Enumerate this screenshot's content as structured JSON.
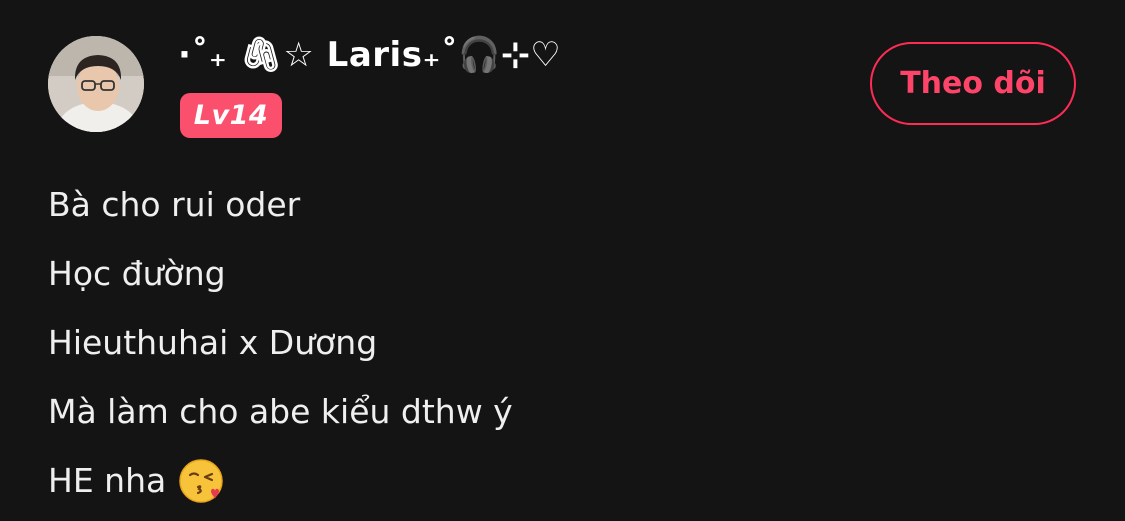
{
  "profile": {
    "username": "·˚₊ 🖇☆ Laris₊˚🎧⊹♡",
    "level": "Lv14",
    "avatar_icon": "user-avatar-photo"
  },
  "actions": {
    "follow_label": "Theo dõi"
  },
  "bio": {
    "lines": [
      "Bà cho rui oder",
      "Học đường",
      "Hieuthuhai x Dương",
      "Mà làm cho abe kiểu dthw ý",
      "HE nha"
    ],
    "trailing_emoji": "kissing-face-with-heart-emoji"
  },
  "colors": {
    "background": "#141414",
    "accent": "#fe2c55",
    "badge": "#fb4f6e",
    "text": "#f2f2f2"
  }
}
